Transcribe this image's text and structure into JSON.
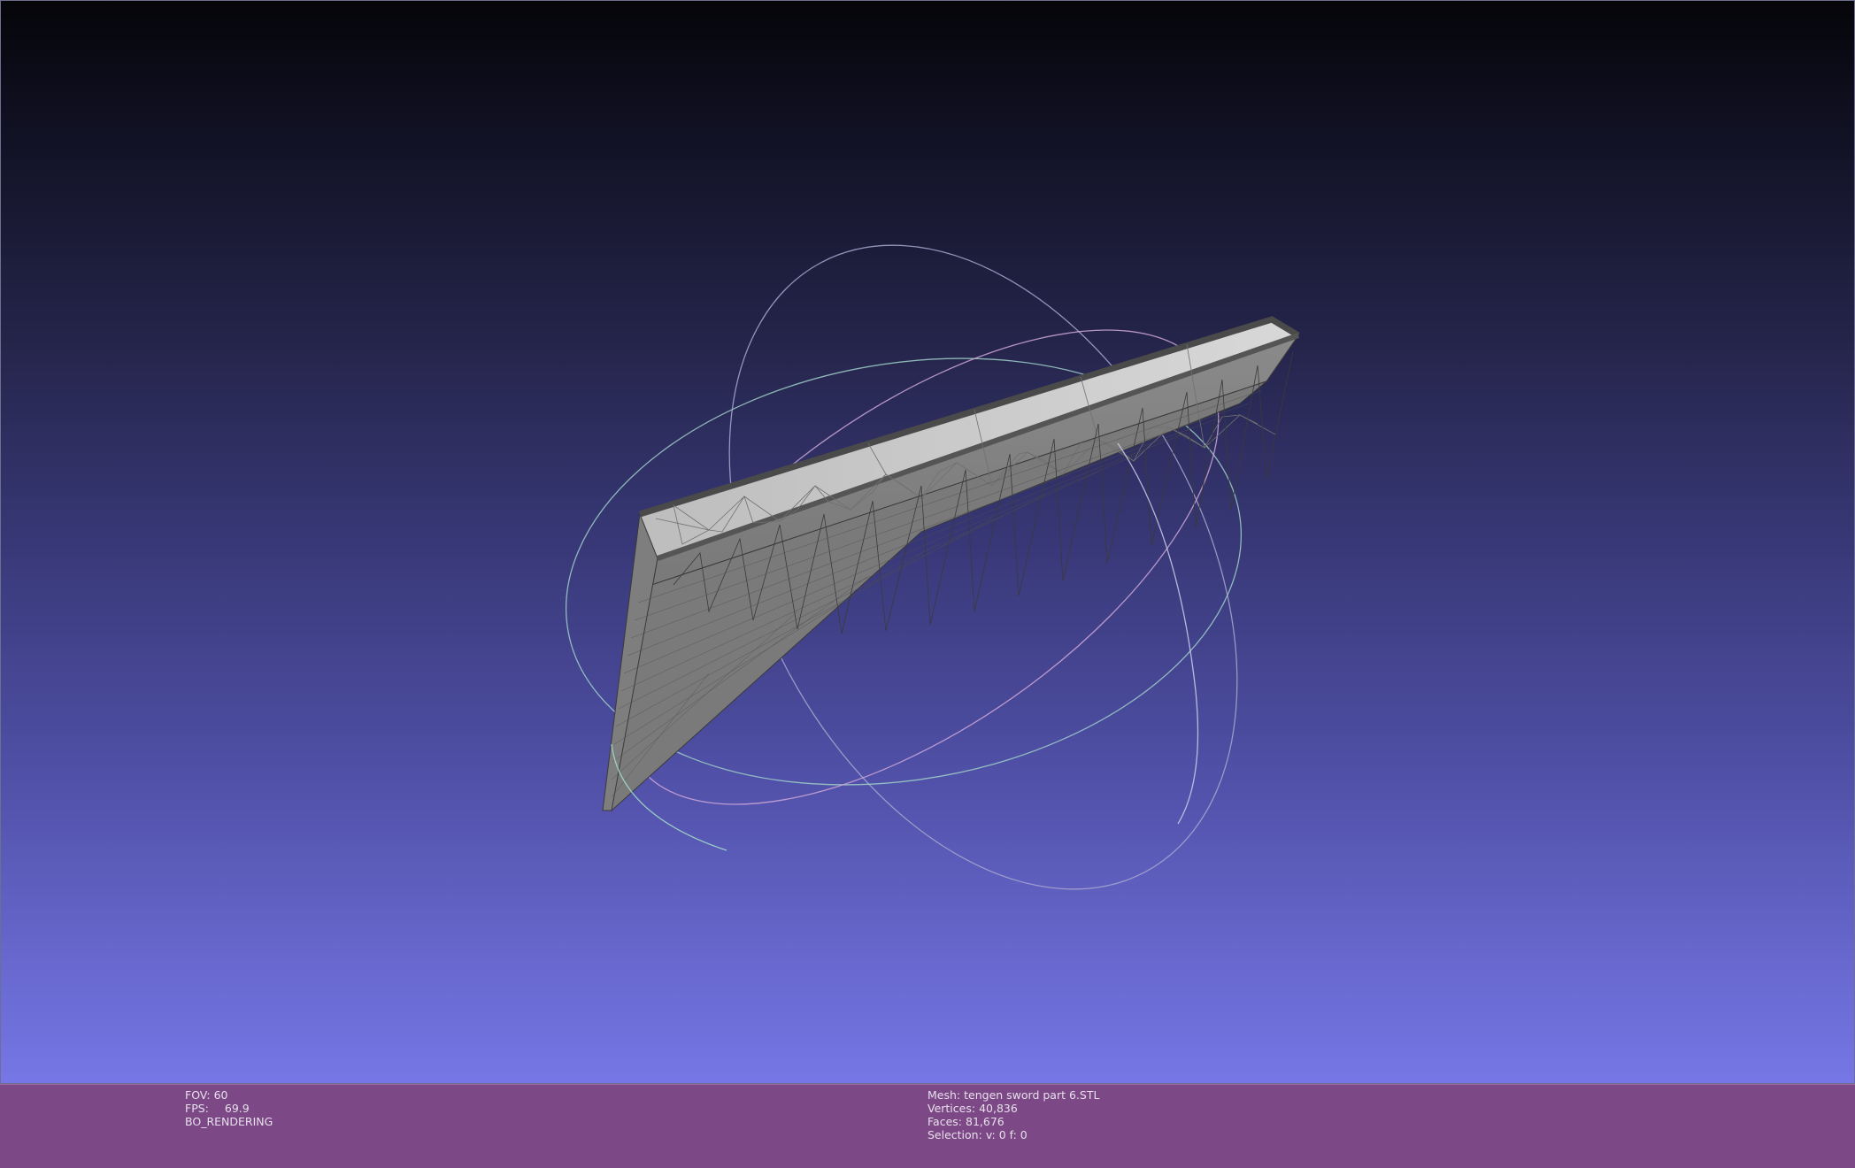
{
  "viewport": {
    "background_top": "#05050a",
    "background_bottom": "#7676e6",
    "mesh_color": "#9a9a9a",
    "trackball_colors": [
      "#a0a0c8",
      "#d0a0d8",
      "#a0d8c0"
    ]
  },
  "info_bar": {
    "background": "#7c4885",
    "render": {
      "fov_label": "FOV:",
      "fov_value": "60",
      "fps_label": "FPS:",
      "fps_value": "69.9",
      "mode": "BO_RENDERING"
    },
    "mesh": {
      "mesh_label": "Mesh:",
      "mesh_name": "tengen sword part 6.STL",
      "vertices_label": "Vertices:",
      "vertices_value": "40,836",
      "faces_label": "Faces:",
      "faces_value": "81,676",
      "selection_label": "Selection:",
      "selection_value": "v: 0 f: 0"
    }
  }
}
